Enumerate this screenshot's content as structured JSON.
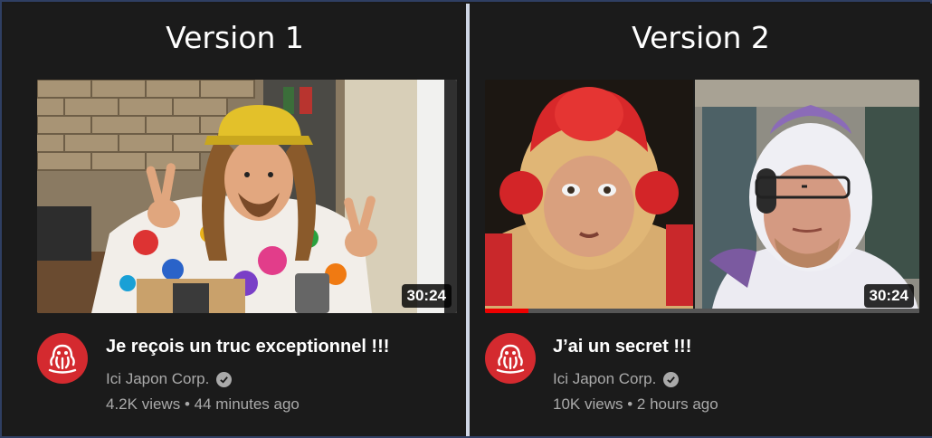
{
  "versions": [
    {
      "heading": "Version 1",
      "title": "Je reçois un truc exceptionnel !!!",
      "channel": "Ici Japon Corp.",
      "views": "4.2K views",
      "age": "44 minutes ago",
      "duration": "30:24",
      "watch_progress": 0
    },
    {
      "heading": "Version 2",
      "title": "J’ai un secret !!!",
      "channel": "Ici Japon Corp.",
      "views": "10K views",
      "age": "2 hours ago",
      "duration": "30:24",
      "watch_progress": 0.1
    }
  ],
  "colors": {
    "avatar": "#d42a2f",
    "progress": "#ee0000",
    "text_secondary": "#aaaaaa"
  },
  "icons": {
    "avatar": "octopus-logo-icon",
    "verified": "verified-check-icon"
  }
}
